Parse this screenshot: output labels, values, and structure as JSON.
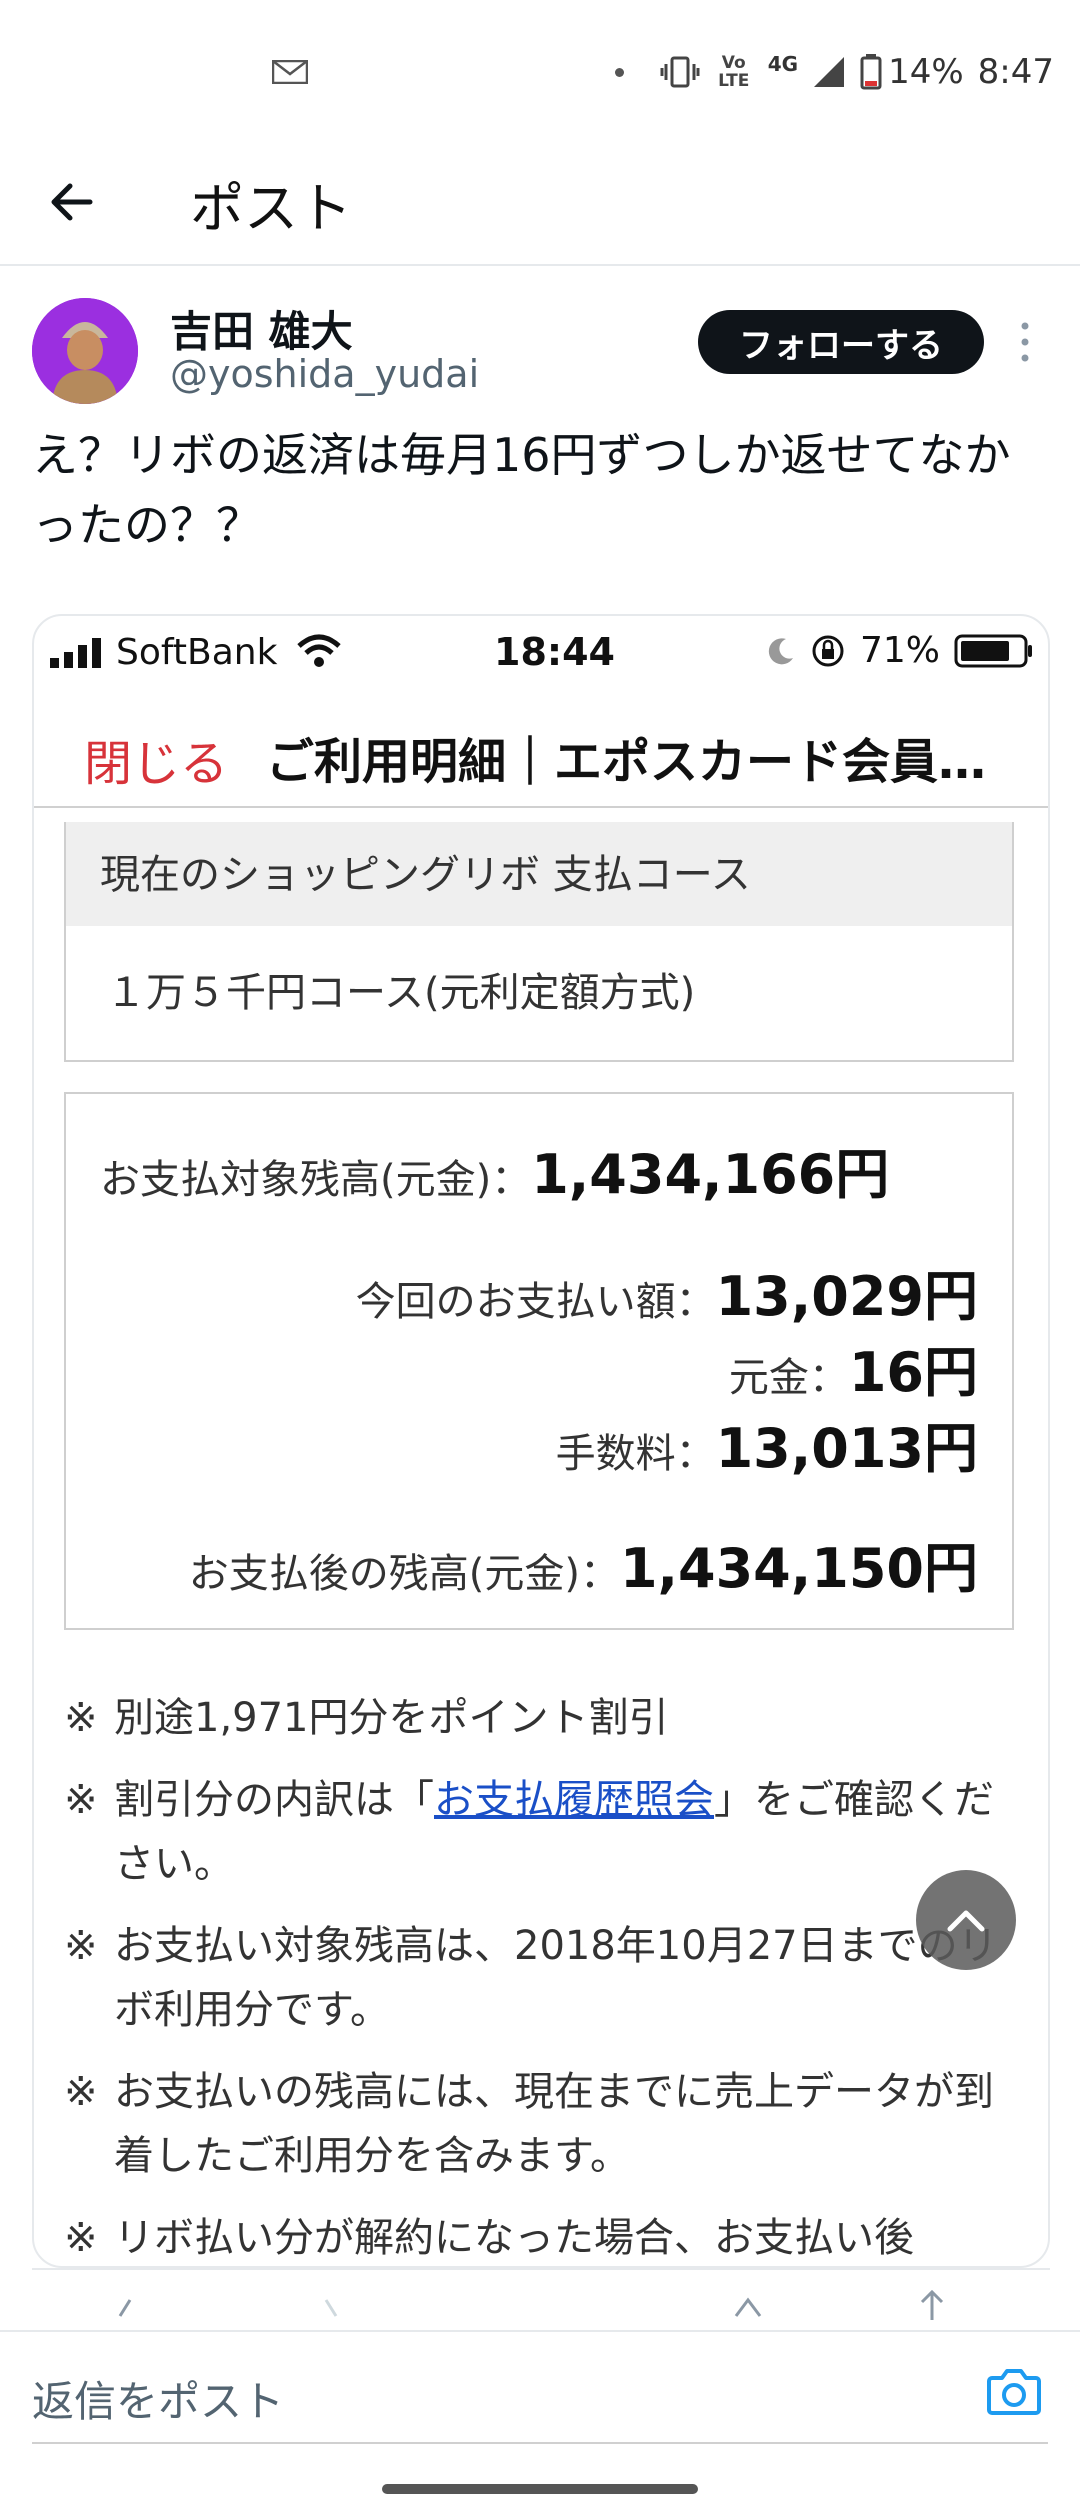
{
  "status_bar": {
    "battery": "14%",
    "time": "8:47",
    "network": "4G",
    "volte": "Vo LTE"
  },
  "header": {
    "title": "ポスト"
  },
  "post": {
    "author_name": "吉田 雄大",
    "author_handle": "@yoshida_yudai",
    "follow_label": "フォローする",
    "text": "え？リボの返済は毎月16円ずつしか返せてなかったの？？"
  },
  "embedded_screenshot": {
    "ios_status": {
      "carrier": "SoftBank",
      "time": "18:44",
      "battery": "71%"
    },
    "web_header": {
      "close_label": "閉じる",
      "title": "ご利用明細｜エポスカード会員…"
    },
    "course": {
      "heading": "現在のショッピングリボ 支払コース",
      "value": "１万５千円コース(元利定額方式)"
    },
    "balance": {
      "target_label": "お支払対象残高(元金)：",
      "target_value": "1,434,166円",
      "payment_label": "今回のお支払い額：",
      "payment_value": "13,029円",
      "principal_label": "元金：",
      "principal_value": "16円",
      "fee_label": "手数料：",
      "fee_value": "13,013円",
      "after_label": "お支払後の残高(元金)：",
      "after_value": "1,434,150円"
    },
    "notes": {
      "mark": "※",
      "n1": "別途1,971円分をポイント割引",
      "n2_before": "割引分の内訳は「",
      "n2_link": "お支払履歴照会",
      "n2_after": "」をご確認ください。",
      "n3": "お支払い対象残高は、2018年10月27日までのリボ利用分です。",
      "n4": "お支払いの残高には、現在までに売上データが到着したご利用分を含みます。",
      "n5": "リボ払い分が解約になった場合、お支払い後"
    }
  },
  "reply_bar": {
    "placeholder": "返信をポスト"
  }
}
